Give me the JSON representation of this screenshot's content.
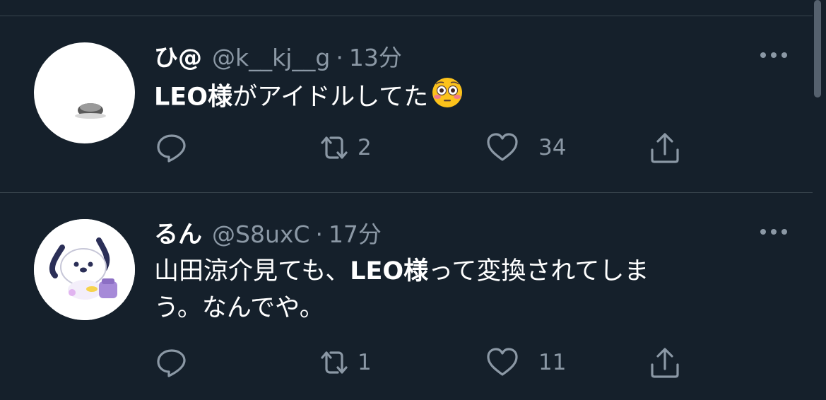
{
  "tweets": [
    {
      "name": "ひ@",
      "handle": "@k__kj__g",
      "time": "13分",
      "text_bold": "LEO様",
      "text_rest": "がアイドルしてた",
      "emoji": "flushed-face",
      "replies": "",
      "retweets": "2",
      "likes": "34"
    },
    {
      "name": "るん",
      "handle": "@S8uxC",
      "time": "17分",
      "text_line1_pre": "山田涼介見ても、",
      "text_line1_bold": "LEO様",
      "text_line1_post": "って変換されてしま",
      "text_line2": "う。なんでや。",
      "replies": "",
      "retweets": "1",
      "likes": "11"
    }
  ],
  "separator": "·",
  "colors": {
    "background": "#15202b",
    "text": "#ffffff",
    "secondary": "#8b98a5",
    "divider": "#38444d"
  }
}
